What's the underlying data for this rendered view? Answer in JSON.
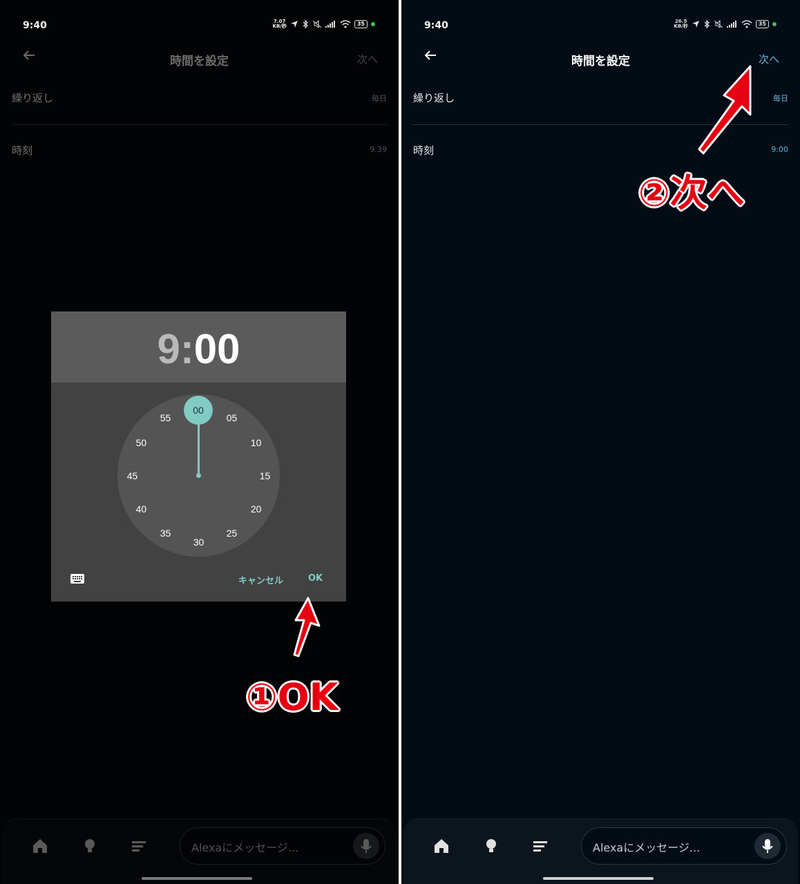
{
  "left": {
    "status": {
      "time": "9:40",
      "net_speed_value": "7.07",
      "net_speed_unit": "KB/秒",
      "battery": "35"
    },
    "header": {
      "title": "時間を設定",
      "next": "次へ"
    },
    "rows": [
      {
        "label": "繰り返し",
        "value": "毎日"
      },
      {
        "label": "時刻",
        "value": "9:39"
      }
    ],
    "picker": {
      "hour": "9",
      "sep": ":",
      "minute": "00",
      "selected": "00",
      "numbers": [
        "05",
        "10",
        "15",
        "20",
        "25",
        "30",
        "35",
        "40",
        "45",
        "50",
        "55"
      ],
      "cancel": "キャンセル",
      "ok": "OK"
    },
    "bottom": {
      "placeholder": "Alexaにメッセージ..."
    },
    "annotation": "①OK"
  },
  "right": {
    "status": {
      "time": "9:40",
      "net_speed_value": "26.5",
      "net_speed_unit": "KB/秒",
      "battery": "35"
    },
    "header": {
      "title": "時間を設定",
      "next": "次へ"
    },
    "rows": [
      {
        "label": "繰り返し",
        "value": "毎日"
      },
      {
        "label": "時刻",
        "value": "9:00"
      }
    ],
    "bottom": {
      "placeholder": "Alexaにメッセージ..."
    },
    "annotation": "②次へ"
  },
  "colors": {
    "accent_teal": "#80cbc4",
    "accent_blue": "#5fb6e0",
    "annotation_red": "#e60012"
  }
}
